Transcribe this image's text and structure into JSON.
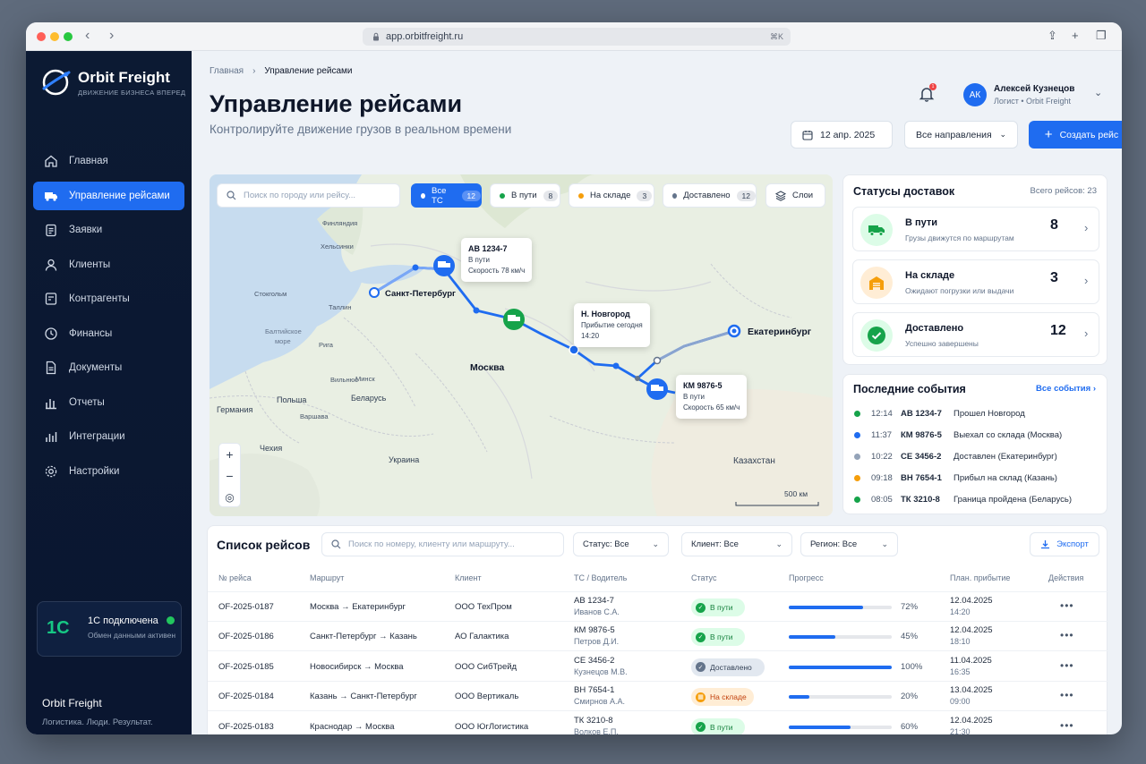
{
  "browser": {
    "url": "app.orbitfreight.ru",
    "shortcut": "⌘K"
  },
  "brand": {
    "name": "Orbit Freight",
    "tagline": "ДВИЖЕНИЕ БИЗНЕСА ВПЕРЕД",
    "footer_name": "Orbit Freight",
    "footer_slogan": "Логистика. Люди. Результат."
  },
  "sidebar": {
    "items": [
      {
        "label": "Главная",
        "icon": "home-icon"
      },
      {
        "label": "Управление рейсами",
        "icon": "truck-icon",
        "active": true
      },
      {
        "label": "Заявки",
        "icon": "clipboard-icon"
      },
      {
        "label": "Клиенты",
        "icon": "user-icon"
      },
      {
        "label": "Контрагенты",
        "icon": "contract-icon"
      },
      {
        "label": "Финансы",
        "icon": "clock-icon"
      },
      {
        "label": "Документы",
        "icon": "document-icon"
      },
      {
        "label": "Отчеты",
        "icon": "bar-chart-icon"
      },
      {
        "label": "Интеграции",
        "icon": "integrations-icon"
      },
      {
        "label": "Настройки",
        "icon": "gear-icon"
      }
    ],
    "onec": {
      "logo": "1С",
      "title": "1С подключена",
      "subtitle": "Обмен данными активен"
    }
  },
  "header": {
    "breadcrumb": [
      "Главная",
      "Управление рейсами"
    ],
    "title": "Управление рейсами",
    "subtitle": "Контролируйте движение грузов в реальном времени",
    "notifications": "1",
    "user": {
      "initials": "АК",
      "name": "Алексей Кузнецов",
      "role": "Логист • Orbit Freight"
    },
    "date": "12 апр. 2025",
    "direction": "Все направления",
    "create_label": "Создать рейс"
  },
  "map": {
    "search_placeholder": "Поиск по городу или рейсу...",
    "filters": [
      {
        "label": "Все ТС",
        "count": "12",
        "color": "#ffffff"
      },
      {
        "label": "В пути",
        "count": "8",
        "color": "#16a34a"
      },
      {
        "label": "На складе",
        "count": "3",
        "color": "#f59e0b"
      },
      {
        "label": "Доставлено",
        "count": "12",
        "color": "#64748b"
      }
    ],
    "layers_label": "Слои",
    "labels": {
      "finland": "Финляндия",
      "helsinki": "Хельсинки",
      "stockholm": "Стокгольм",
      "tallinn": "Таллин",
      "baltic": "Балтийское",
      "baltic2": "море",
      "riga": "Рига",
      "vilnius": "Вильнюс",
      "minsk": "Минск",
      "belarus": "Беларусь",
      "poland": "Польша",
      "warsaw": "Варшава",
      "germany": "Германия",
      "czech": "Чехия",
      "ukraine": "Украина",
      "kazakhstan": "Казахстан",
      "moscow": "Москва",
      "spb": "Санкт-Петербург",
      "ekb": "Екатеринбург"
    },
    "popups": [
      {
        "title": "АВ 1234-7",
        "line1": "В пути",
        "line2": "Скорость 78 км/ч"
      },
      {
        "title": "Н. Новгород",
        "line1": "Прибытие сегодня",
        "line2": "14:20"
      },
      {
        "title": "КМ 9876-5",
        "line1": "В пути",
        "line2": "Скорость 65 км/ч"
      }
    ],
    "scale": "500 км"
  },
  "statuses": {
    "title": "Статусы доставок",
    "total": "Всего рейсов: 23",
    "items": [
      {
        "name": "В пути",
        "desc": "Грузы движутся по маршрутам",
        "count": "8",
        "color": "#16a34a",
        "icon": "truck-icon"
      },
      {
        "name": "На складе",
        "desc": "Ожидают погрузки или выдачи",
        "count": "3",
        "color": "#f59e0b",
        "icon": "warehouse-icon"
      },
      {
        "name": "Доставлено",
        "desc": "Успешно завершены",
        "count": "12",
        "color": "#16a34a",
        "icon": "check-icon"
      }
    ]
  },
  "events": {
    "title": "Последние события",
    "all_label": "Все события",
    "items": [
      {
        "time": "12:14",
        "code": "АВ 1234-7",
        "text": "Прошел Новгород",
        "color": "#16a34a"
      },
      {
        "time": "11:37",
        "code": "КМ 9876-5",
        "text": "Выехал со склада (Москва)",
        "color": "#1f6cf0"
      },
      {
        "time": "10:22",
        "code": "СЕ 3456-2",
        "text": "Доставлен (Екатеринбург)",
        "color": "#94a3b8"
      },
      {
        "time": "09:18",
        "code": "ВН 7654-1",
        "text": "Прибыл на склад (Казань)",
        "color": "#f59e0b"
      },
      {
        "time": "08:05",
        "code": "ТК 3210-8",
        "text": "Граница пройдена (Беларусь)",
        "color": "#16a34a"
      }
    ]
  },
  "trips": {
    "title": "Список рейсов",
    "search_placeholder": "Поиск по номеру, клиенту или маршруту...",
    "filters": [
      "Статус: Все",
      "Клиент: Все",
      "Регион: Все"
    ],
    "export_label": "Экспорт",
    "columns": [
      "№ рейса",
      "Маршрут",
      "Клиент",
      "ТС / Водитель",
      "Статус",
      "Прогресс",
      "План. прибытие",
      "Действия"
    ],
    "rows": [
      {
        "id": "OF-2025-0187",
        "route": "Москва → Екатеринбург",
        "client": "ООО ТехПром",
        "vehicle": "АВ 1234-7",
        "driver": "Иванов С.А.",
        "status": "В пути",
        "status_type": "transit",
        "progress": 72,
        "progress_label": "72%",
        "date": "12.04.2025",
        "time": "14:20"
      },
      {
        "id": "OF-2025-0186",
        "route": "Санкт-Петербург → Казань",
        "client": "АО Галактика",
        "vehicle": "КМ 9876-5",
        "driver": "Петров Д.И.",
        "status": "В пути",
        "status_type": "transit",
        "progress": 45,
        "progress_label": "45%",
        "date": "12.04.2025",
        "time": "18:10"
      },
      {
        "id": "OF-2025-0185",
        "route": "Новосибирск → Москва",
        "client": "ООО СибТрейд",
        "vehicle": "СЕ 3456-2",
        "driver": "Кузнецов М.В.",
        "status": "Доставлено",
        "status_type": "delivered",
        "progress": 100,
        "progress_label": "100%",
        "date": "11.04.2025",
        "time": "16:35"
      },
      {
        "id": "OF-2025-0184",
        "route": "Казань → Санкт-Петербург",
        "client": "ООО Вертикаль",
        "vehicle": "ВН 7654-1",
        "driver": "Смирнов А.А.",
        "status": "На складе",
        "status_type": "warehouse",
        "progress": 20,
        "progress_label": "20%",
        "date": "13.04.2025",
        "time": "09:00"
      },
      {
        "id": "OF-2025-0183",
        "route": "Краснодар → Москва",
        "client": "ООО ЮгЛогистика",
        "vehicle": "ТК 3210-8",
        "driver": "Волков Е.П.",
        "status": "В пути",
        "status_type": "transit",
        "progress": 60,
        "progress_label": "60%",
        "date": "12.04.2025",
        "time": "21:30"
      }
    ]
  }
}
